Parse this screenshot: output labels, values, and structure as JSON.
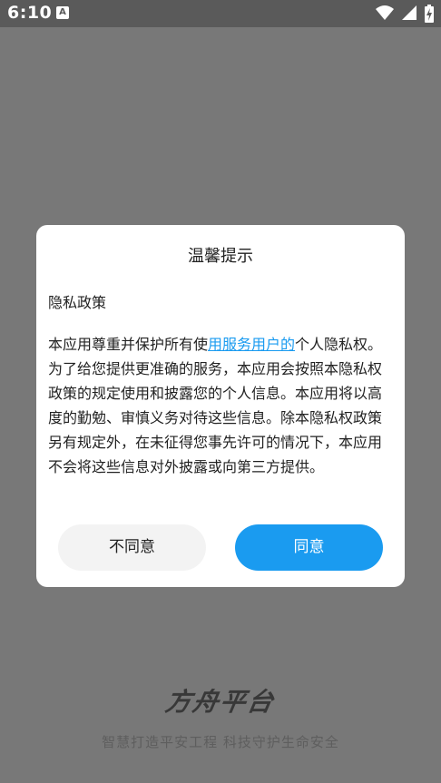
{
  "status_bar": {
    "time": "6:10",
    "notification_glyph": "A"
  },
  "background": {
    "logo_text": "方舟平台",
    "slogan": "智慧打造平安工程  科技守护生命安全"
  },
  "dialog": {
    "title": "温馨提示",
    "subtitle": "隐私政策",
    "body_before_link": "本应用尊重并保护所有使",
    "body_link": "用服务用户的",
    "body_after_link": "个人隐私权。为了给您提供更准确的服务，本应用会按照本隐私权政策的规定使用和披露您的个人信息。本应用将以高度的勤勉、审慎义务对待这些信息。除本隐私权政策另有规定外，在未征得您事先许可的情况下，本应用不会将这些信息对外披露或向第三方提供。",
    "decline_label": "不同意",
    "agree_label": "同意"
  },
  "colors": {
    "accent": "#1a9bf0",
    "overlay": "#787878",
    "decline_button_bg": "#f3f3f3"
  }
}
